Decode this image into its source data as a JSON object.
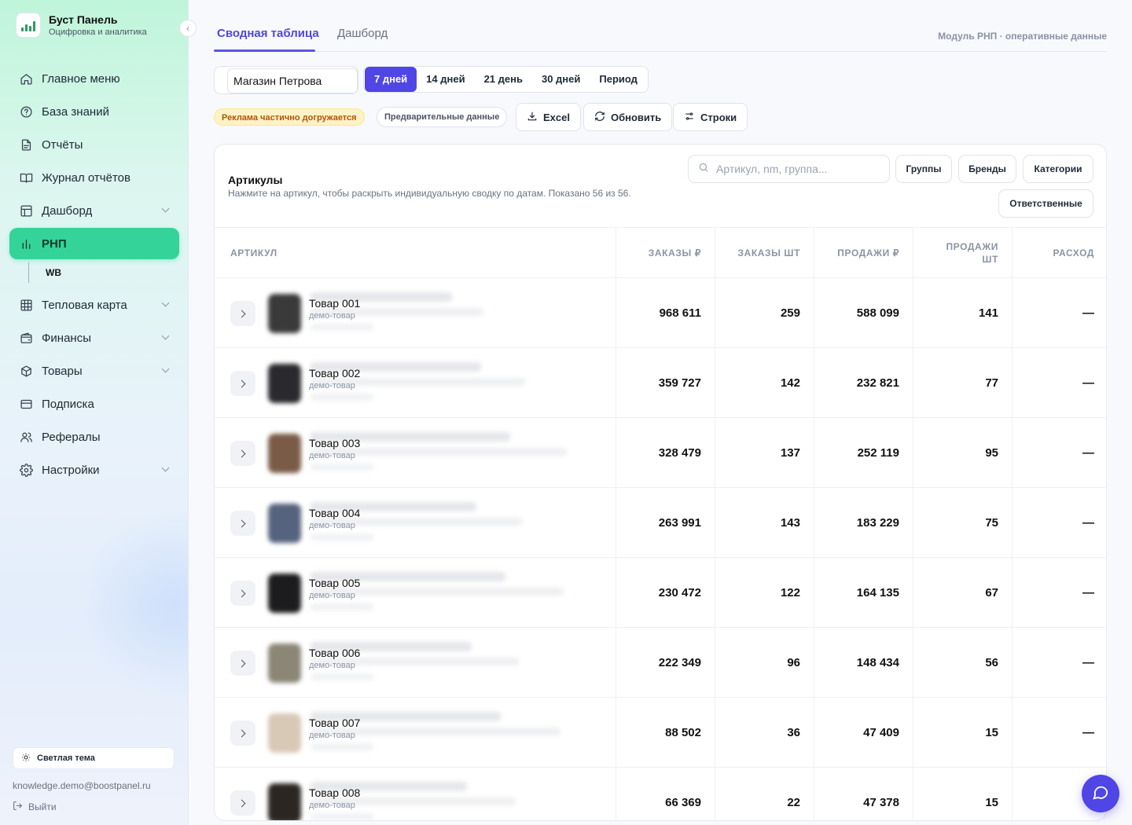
{
  "brand": {
    "title": "Буст Панель",
    "subtitle": "Оцифровка и аналитика"
  },
  "sidebar": {
    "items": [
      {
        "label": "Главное меню",
        "icon": "home-icon",
        "chevron": false,
        "active": false
      },
      {
        "label": "База знаний",
        "icon": "help-circle-icon",
        "chevron": false,
        "active": false
      },
      {
        "label": "Отчёты",
        "icon": "document-icon",
        "chevron": false,
        "active": false
      },
      {
        "label": "Журнал отчётов",
        "icon": "book-open-icon",
        "chevron": false,
        "active": false
      },
      {
        "label": "Дашборд",
        "icon": "layout-icon",
        "chevron": true,
        "active": false
      },
      {
        "label": "РНП",
        "icon": "bar-chart-icon",
        "chevron": false,
        "active": true
      },
      {
        "label": "Тепловая карта",
        "icon": "grid-icon",
        "chevron": true,
        "active": false
      },
      {
        "label": "Финансы",
        "icon": "wallet-icon",
        "chevron": true,
        "active": false
      },
      {
        "label": "Товары",
        "icon": "box-icon",
        "chevron": true,
        "active": false
      },
      {
        "label": "Подписка",
        "icon": "card-icon",
        "chevron": false,
        "active": false
      },
      {
        "label": "Рефералы",
        "icon": "users-icon",
        "chevron": false,
        "active": false
      },
      {
        "label": "Настройки",
        "icon": "gear-icon",
        "chevron": true,
        "active": false
      }
    ],
    "sub_item": "WB",
    "theme_button": "Светлая тема",
    "email": "knowledge.demo@boostpanel.ru",
    "logout": "Выйти"
  },
  "tabs": [
    {
      "label": "Сводная таблица"
    },
    {
      "label": "Дашборд"
    }
  ],
  "module_caption": "Модуль РНП · оперативные данные",
  "store": {
    "value": "Магазин Петрова"
  },
  "periods": [
    {
      "label": "7 дней",
      "active": true
    },
    {
      "label": "14 дней",
      "active": false
    },
    {
      "label": "21 день",
      "active": false
    },
    {
      "label": "30 дней",
      "active": false
    },
    {
      "label": "Период",
      "active": false
    }
  ],
  "status": {
    "ads_warning": "Реклама частично догружается",
    "preliminary": "Предварительные данные"
  },
  "actions": {
    "excel": "Excel",
    "refresh": "Обновить",
    "rows": "Строки"
  },
  "table_card": {
    "title": "Артикулы",
    "subtitle": "Нажмите на артикул, чтобы раскрыть индивидуальную сводку по датам. Показано 56 из 56.",
    "search_placeholder": "Артикул, nm, группа...",
    "filters": {
      "groups": "Группы",
      "brands": "Бренды",
      "categories": "Категории",
      "responsible": "Ответственные"
    }
  },
  "columns": [
    "АРТИКУЛ",
    "ЗАКАЗЫ ₽",
    "ЗАКАЗЫ ШТ",
    "ПРОДАЖИ ₽",
    "ПРОДАЖИ ШТ",
    "РАСХОД"
  ],
  "rows": [
    {
      "name": "Товар 001",
      "tag": "демо-товар",
      "orders_rub": "968 611",
      "orders_qty": "259",
      "sales_rub": "588 099",
      "sales_qty": "141",
      "expense": "—",
      "photo": "#3a3a3a"
    },
    {
      "name": "Товар 002",
      "tag": "демо-товар",
      "orders_rub": "359 727",
      "orders_qty": "142",
      "sales_rub": "232 821",
      "sales_qty": "77",
      "expense": "—",
      "photo": "#2a2a2e"
    },
    {
      "name": "Товар 003",
      "tag": "демо-товар",
      "orders_rub": "328 479",
      "orders_qty": "137",
      "sales_rub": "252 119",
      "sales_qty": "95",
      "expense": "—",
      "photo": "#7a5b48"
    },
    {
      "name": "Товар 004",
      "tag": "демо-товар",
      "orders_rub": "263 991",
      "orders_qty": "143",
      "sales_rub": "183 229",
      "sales_qty": "75",
      "expense": "—",
      "photo": "#56637e"
    },
    {
      "name": "Товар 005",
      "tag": "демо-товар",
      "orders_rub": "230 472",
      "orders_qty": "122",
      "sales_rub": "164 135",
      "sales_qty": "67",
      "expense": "—",
      "photo": "#1c1c1f"
    },
    {
      "name": "Товар 006",
      "tag": "демо-товар",
      "orders_rub": "222 349",
      "orders_qty": "96",
      "sales_rub": "148 434",
      "sales_qty": "56",
      "expense": "—",
      "photo": "#8b8676"
    },
    {
      "name": "Товар 007",
      "tag": "демо-товар",
      "orders_rub": "88 502",
      "orders_qty": "36",
      "sales_rub": "47 409",
      "sales_qty": "15",
      "expense": "—",
      "photo": "#d8c8b6"
    },
    {
      "name": "Товар 008",
      "tag": "демо-товар",
      "orders_rub": "66 369",
      "orders_qty": "22",
      "sales_rub": "47 378",
      "sales_qty": "15",
      "expense": "",
      "photo": "#2b2622"
    }
  ],
  "colors": {
    "accent": "#4f46e5",
    "active_nav": "#34d399",
    "warning_bg": "#fef3c7",
    "warning_text": "#b45309"
  }
}
